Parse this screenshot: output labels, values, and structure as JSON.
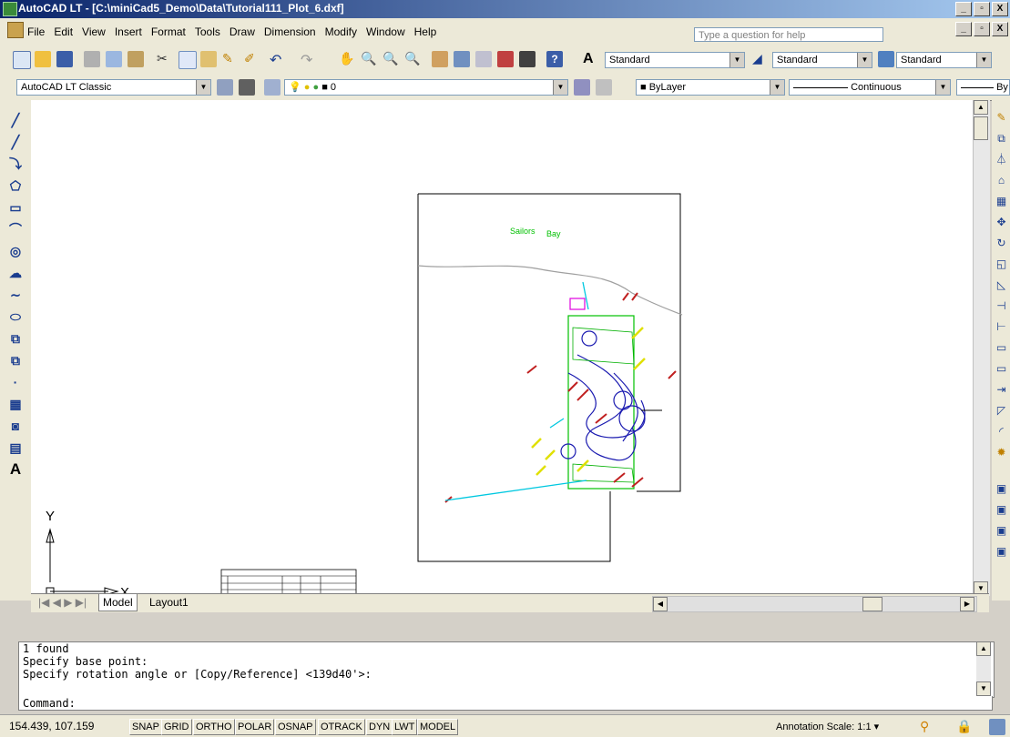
{
  "window": {
    "title": "AutoCAD LT - [C:\\miniCad5_Demo\\Data\\Tutorial111_Plot_6.dxf]",
    "min": "_",
    "max": "вр",
    "close": "X"
  },
  "menu": {
    "items": [
      "File",
      "Edit",
      "View",
      "Insert",
      "Format",
      "Tools",
      "Draw",
      "Dimension",
      "Modify",
      "Window",
      "Help"
    ],
    "help_placeholder": "Type a question for help"
  },
  "toolbar1": {
    "text_style": "Standard",
    "dim_style": "Standard",
    "table_style": "Standard"
  },
  "toolbar2": {
    "workspace": "AutoCAD LT Classic",
    "layer": "0",
    "color": "ByLayer",
    "linetype": "Continuous",
    "lineweight": "By"
  },
  "drawing": {
    "label_sailors": "Sailors",
    "label_bay": "Bay",
    "ucs_x": "X",
    "ucs_y": "Y"
  },
  "tabs": {
    "model": "Model",
    "layout1": "Layout1"
  },
  "command": {
    "history": [
      "1 found",
      "Specify base point:",
      "Specify rotation angle or [Copy/Reference] <139d40'>:"
    ],
    "prompt": "Command:"
  },
  "status": {
    "coords": "154.439, 107.159",
    "buttons": [
      "SNAP",
      "GRID",
      "ORTHO",
      "POLAR",
      "OSNAP",
      "OTRACK",
      "DYN",
      "LWT",
      "MODEL"
    ],
    "annotation_scale_label": "Annotation Scale:",
    "annotation_scale_value": "1:1"
  }
}
